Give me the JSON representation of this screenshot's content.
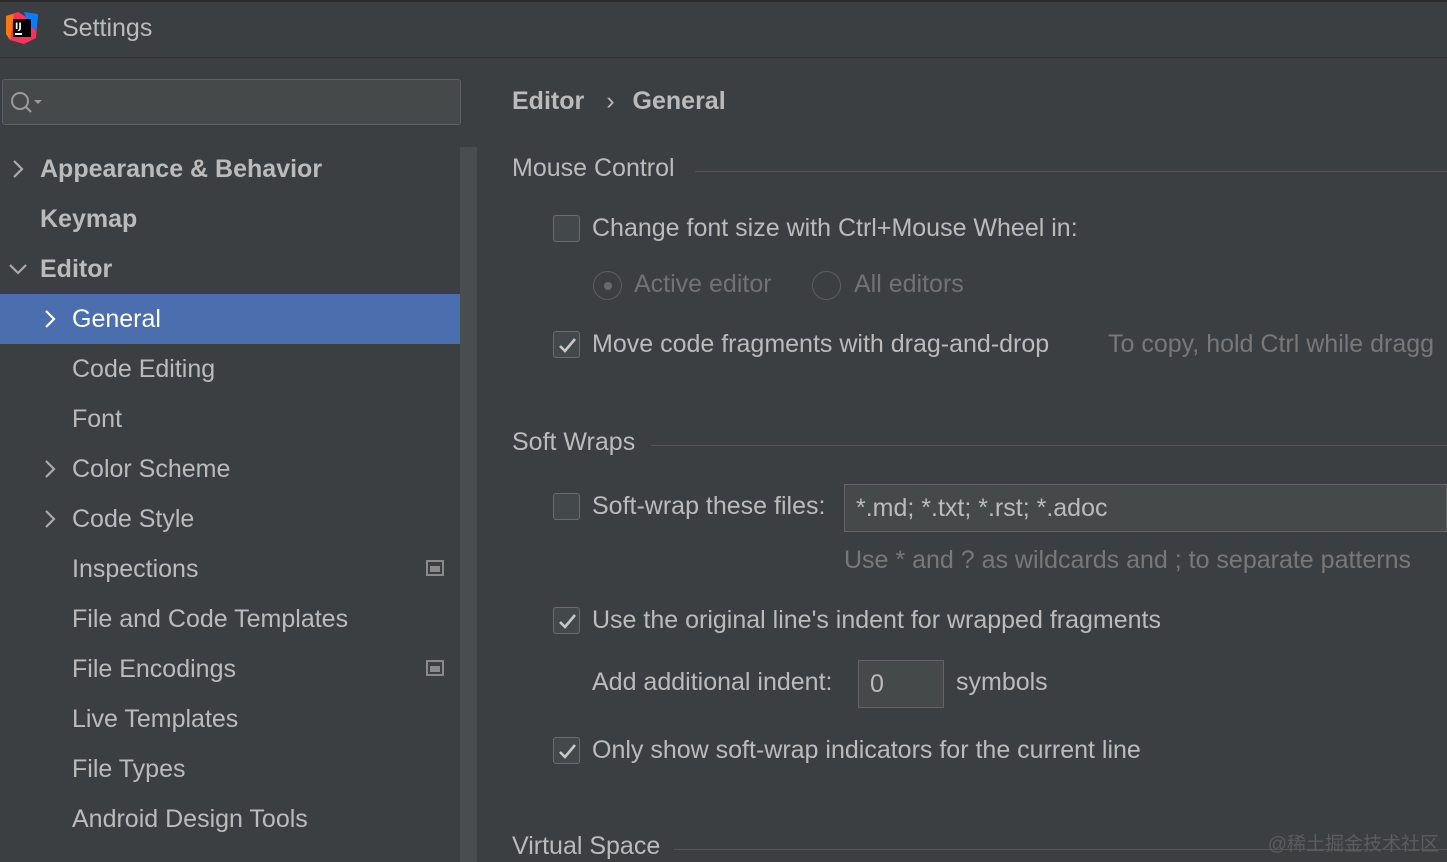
{
  "window": {
    "title": "Settings",
    "app_icon": "intellij-idea-icon"
  },
  "search": {
    "value": "",
    "icon": "search-icon"
  },
  "tree": {
    "items": [
      {
        "label": "Appearance & Behavior",
        "bold": true,
        "chevron": "right",
        "level": 0
      },
      {
        "label": "Keymap",
        "bold": true,
        "chevron": "none",
        "level": 0
      },
      {
        "label": "Editor",
        "bold": true,
        "chevron": "down",
        "level": 0
      },
      {
        "label": "General",
        "bold": false,
        "chevron": "right",
        "level": 1,
        "selected": true
      },
      {
        "label": "Code Editing",
        "bold": false,
        "chevron": "none",
        "level": 1
      },
      {
        "label": "Font",
        "bold": false,
        "chevron": "none",
        "level": 1
      },
      {
        "label": "Color Scheme",
        "bold": false,
        "chevron": "right",
        "level": 1
      },
      {
        "label": "Code Style",
        "bold": false,
        "chevron": "right",
        "level": 1
      },
      {
        "label": "Inspections",
        "bold": false,
        "chevron": "none",
        "level": 1,
        "project_icon": true
      },
      {
        "label": "File and Code Templates",
        "bold": false,
        "chevron": "none",
        "level": 1
      },
      {
        "label": "File Encodings",
        "bold": false,
        "chevron": "none",
        "level": 1,
        "project_icon": true
      },
      {
        "label": "Live Templates",
        "bold": false,
        "chevron": "none",
        "level": 1
      },
      {
        "label": "File Types",
        "bold": false,
        "chevron": "none",
        "level": 1
      },
      {
        "label": "Android Design Tools",
        "bold": false,
        "chevron": "none",
        "level": 1
      }
    ]
  },
  "breadcrumb": {
    "parent": "Editor",
    "separator": "›",
    "current": "General"
  },
  "mouse_control": {
    "title": "Mouse Control",
    "font_size_label": "Change font size with Ctrl+Mouse Wheel in:",
    "font_size_checked": false,
    "radio_active_label": "Active editor",
    "radio_all_label": "All editors",
    "radio_selected": "Active editor",
    "drag_drop_label": "Move code fragments with drag-and-drop",
    "drag_drop_checked": true,
    "drag_drop_hint": "To copy, hold Ctrl while dragg"
  },
  "soft_wraps": {
    "title": "Soft Wraps",
    "wrap_files_label": "Soft-wrap these files:",
    "wrap_files_checked": false,
    "wrap_files_value": "*.md; *.txt; *.rst; *.adoc",
    "wrap_files_hint": "Use * and ? as wildcards and ; to separate patterns",
    "indent_label": "Use the original line's indent for wrapped fragments",
    "indent_checked": true,
    "additional_indent_label": "Add additional indent:",
    "additional_indent_value": "0",
    "additional_indent_unit": "symbols",
    "indicators_label": "Only show soft-wrap indicators for the current line",
    "indicators_checked": true
  },
  "virtual_space": {
    "title": "Virtual Space"
  },
  "watermark": "@稀土掘金技术社区"
}
